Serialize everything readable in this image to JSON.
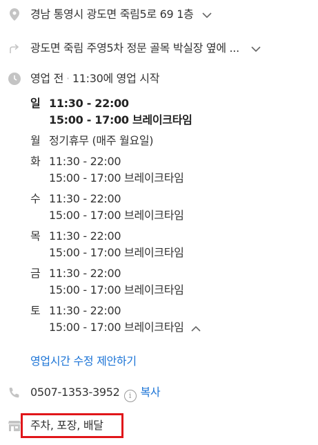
{
  "address": {
    "text": "경남 통영시 광도면 죽림5로 69 1층"
  },
  "directions": {
    "text": "광도면 죽림 주영5차 정문 골목 박실장 옆에 ..."
  },
  "status": {
    "state": "영업 전",
    "separator": "·",
    "detail": "11:30에 영업 시작"
  },
  "hours": [
    {
      "day": "일",
      "line1": "11:30 - 22:00",
      "line2": "15:00 - 17:00 브레이크타임",
      "today": true
    },
    {
      "day": "월",
      "line1": "정기휴무 (매주 월요일)",
      "line2": ""
    },
    {
      "day": "화",
      "line1": "11:30 - 22:00",
      "line2": "15:00 - 17:00 브레이크타임"
    },
    {
      "day": "수",
      "line1": "11:30 - 22:00",
      "line2": "15:00 - 17:00 브레이크타임"
    },
    {
      "day": "목",
      "line1": "11:30 - 22:00",
      "line2": "15:00 - 17:00 브레이크타임"
    },
    {
      "day": "금",
      "line1": "11:30 - 22:00",
      "line2": "15:00 - 17:00 브레이크타임"
    },
    {
      "day": "토",
      "line1": "11:30 - 22:00",
      "line2": "15:00 - 17:00 브레이크타임"
    }
  ],
  "suggest_hours_link": "영업시간 수정 제안하기",
  "phone": {
    "number": "0507-1353-3952",
    "info_glyph": "i",
    "copy_label": "복사"
  },
  "services": {
    "text": "주차, 포장, 배달"
  },
  "colors": {
    "link": "#1a73d6",
    "highlight": "#e0161a",
    "icon": "#bbbbbb"
  },
  "icons": [
    "location-pin-icon",
    "direction-arrow-icon",
    "clock-icon",
    "phone-icon",
    "store-icon",
    "chevron-down-icon",
    "chevron-up-icon",
    "info-icon"
  ]
}
